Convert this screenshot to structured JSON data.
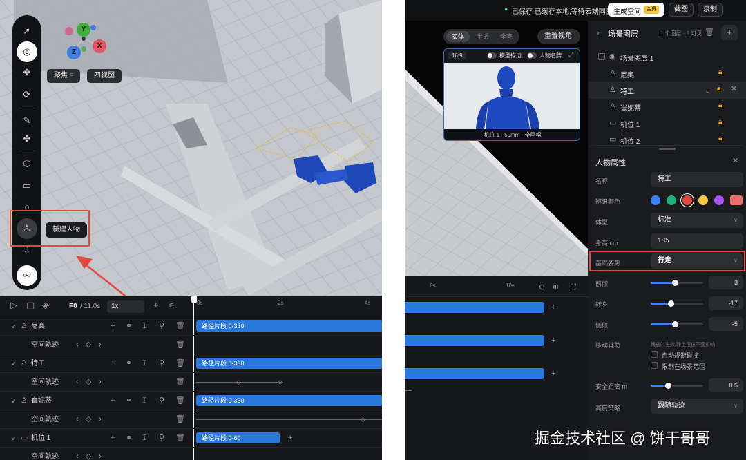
{
  "left": {
    "gizmo": {
      "y": "Y",
      "z": "Z",
      "x": "X"
    },
    "view_buttons": {
      "focus": "聚焦",
      "focus_key": "F",
      "four_view": "四视图"
    },
    "tooltip": "新建人物",
    "timeline": {
      "frame": "F0",
      "total": "/ 11.0s",
      "speed": "1x",
      "ticks": [
        "0s",
        "2s",
        "4s"
      ],
      "tracks": [
        {
          "name": "尼奥",
          "type": "character",
          "clip": "路径片段 0-330",
          "sub": "空间轨迹"
        },
        {
          "name": "特工",
          "type": "character",
          "clip": "路径片段 0-330",
          "sub": "空间轨迹"
        },
        {
          "name": "崔妮蒂",
          "type": "character",
          "clip": "路径片段 0-330",
          "sub": "空间轨迹"
        },
        {
          "name": "机位 1",
          "type": "camera",
          "clip": "路径片段 0-60",
          "sub": "空间轨迹"
        }
      ]
    },
    "colors": {
      "accent": "#2a78dc",
      "highlight": "#e4473f"
    }
  },
  "right": {
    "topbar": {
      "saved": "已保存",
      "sync_status": "已缓存本地,等待云端同步",
      "generate": "生成空间",
      "member_badge": "会员",
      "screenshot": "截图",
      "record": "录制"
    },
    "render_modes": [
      "实体",
      "半透",
      "全亮"
    ],
    "reset_view": "重置视角",
    "preview": {
      "ratio": "16:9",
      "outline": "模型描边",
      "nameplate": "人物名牌",
      "caption": "机位 1 · 50mm · 全画幅"
    },
    "layers": {
      "title": "场景图层",
      "summary": "1 个图层 · 1 可见",
      "group": "场景图层 1",
      "items": [
        {
          "name": "尼奥",
          "type": "character"
        },
        {
          "name": "特工",
          "type": "character"
        },
        {
          "name": "崔妮蒂",
          "type": "character"
        },
        {
          "name": "机位 1",
          "type": "camera"
        },
        {
          "name": "机位 2",
          "type": "camera"
        }
      ]
    },
    "timeline_ticks": [
      "8s",
      "10s"
    ],
    "props": {
      "title": "人物属性",
      "name_label": "名称",
      "name_value": "特工",
      "color_label": "辨识颜色",
      "swatches": [
        "#3b82f6",
        "#22b07d",
        "#e4473f",
        "#f5c542",
        "#a855f7",
        "#f06b6b"
      ],
      "body_label": "体型",
      "body_value": "标准",
      "height_label": "身高 cm",
      "height_value": "185",
      "pose_label": "基础姿势",
      "pose_value": "行走",
      "lean_label": "前倾",
      "lean_value": "3",
      "turn_label": "转身",
      "turn_value": "-17",
      "tilt_label": "侧倾",
      "tilt_value": "-5",
      "assist_label": "移动辅助",
      "assist_hint": "播放时生效,静止摆位不受影响",
      "avoid_label": "自动规避碰撞",
      "limit_label": "限制在场景范围",
      "safe_label": "安全距离 m",
      "safe_value": "0.5",
      "height_strategy_label": "高度策略",
      "height_strategy_value": "跟随轨迹"
    }
  },
  "watermark": "掘金技术社区 @ 饼干哥哥"
}
